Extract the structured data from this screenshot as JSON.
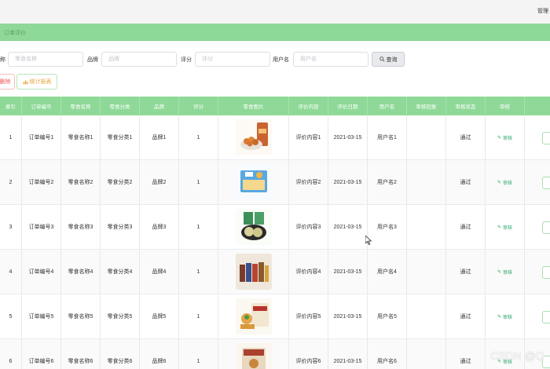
{
  "header": {
    "admin_label": "管理"
  },
  "breadcrumb": {
    "label": "订单评价"
  },
  "search": {
    "fields": [
      {
        "label": "称",
        "placeholder": "零食名称"
      },
      {
        "label": "品牌",
        "placeholder": "品牌"
      },
      {
        "label": "评分",
        "placeholder": "评分"
      },
      {
        "label": "用户名",
        "placeholder": "用户名"
      }
    ],
    "query_label": "查询"
  },
  "actions": {
    "delete_label": "删除",
    "stat_label": "统计报表"
  },
  "table": {
    "headers": [
      "索引",
      "订单编号",
      "零食名称",
      "零食分类",
      "品牌",
      "评分",
      "零食图片",
      "评价内容",
      "评价日期",
      "用户名",
      "审核回复",
      "审核状态",
      "审核",
      ""
    ],
    "rows": [
      {
        "index": "1",
        "order": "订单编号1",
        "name": "零食名称1",
        "category": "零食分类1",
        "brand": "品牌1",
        "score": "1",
        "image": "snack-photo-1",
        "content": "评价内容1",
        "date": "2021-03-15",
        "user": "用户名1",
        "reply": "",
        "status": "通过",
        "review": "审核"
      },
      {
        "index": "2",
        "order": "订单编号2",
        "name": "零食名称2",
        "category": "零食分类2",
        "brand": "品牌2",
        "score": "1",
        "image": "snack-photo-2",
        "content": "评价内容2",
        "date": "2021-03-15",
        "user": "用户名2",
        "reply": "",
        "status": "通过",
        "review": "审核"
      },
      {
        "index": "3",
        "order": "订单编号3",
        "name": "零食名称3",
        "category": "零食分类3",
        "brand": "品牌3",
        "score": "1",
        "image": "snack-photo-3",
        "content": "评价内容3",
        "date": "2021-03-15",
        "user": "用户名3",
        "reply": "",
        "status": "通过",
        "review": "审核"
      },
      {
        "index": "4",
        "order": "订单编号4",
        "name": "零食名称4",
        "category": "零食分类4",
        "brand": "品牌4",
        "score": "1",
        "image": "snack-photo-4",
        "content": "评价内容4",
        "date": "2021-03-15",
        "user": "用户名4",
        "reply": "",
        "status": "通过",
        "review": "审核"
      },
      {
        "index": "5",
        "order": "订单编号5",
        "name": "零食名称5",
        "category": "零食分类5",
        "brand": "品牌5",
        "score": "1",
        "image": "snack-photo-5",
        "content": "评价内容5",
        "date": "2021-03-15",
        "user": "用户名5",
        "reply": "",
        "status": "通过",
        "review": "审核"
      },
      {
        "index": "6",
        "order": "订单编号6",
        "name": "零食名称6",
        "category": "零食分类6",
        "brand": "品牌6",
        "score": "1",
        "image": "snack-photo-6",
        "content": "评价内容6",
        "date": "2021-03-15",
        "user": "用户名6",
        "reply": "",
        "status": "通过",
        "review": "审核"
      }
    ]
  },
  "watermark": "CSDN @Q",
  "colors": {
    "accent": "#8fd998",
    "review": "#2ba86b",
    "delete": "#e55555",
    "stat": "#e6a23c"
  }
}
